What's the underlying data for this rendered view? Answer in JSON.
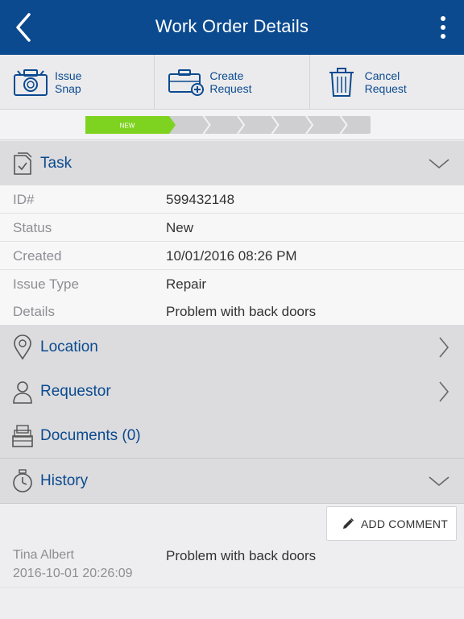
{
  "header": {
    "title": "Work Order Details",
    "back_icon": "chevron-left-icon",
    "menu_icon": "more-vertical-icon"
  },
  "actions": [
    {
      "label": "Issue\nSnap",
      "icon": "camera-icon"
    },
    {
      "label": "Create\nRequest",
      "icon": "toolbox-add-icon"
    },
    {
      "label": "Cancel\nRequest",
      "icon": "trash-icon"
    }
  ],
  "progress": {
    "steps_total": 7,
    "current_step": 1,
    "current_label": "NEW",
    "active_color": "#7ed321",
    "inactive_color": "#cfcfd2"
  },
  "sections": {
    "task": {
      "title": "Task",
      "icon": "task-document-icon"
    },
    "location": {
      "title": "Location",
      "icon": "map-pin-icon"
    },
    "requestor": {
      "title": "Requestor",
      "icon": "person-icon"
    },
    "documents": {
      "title": "Documents (0)",
      "icon": "documents-icon"
    },
    "history": {
      "title": "History",
      "icon": "stopwatch-icon"
    }
  },
  "task_details": [
    {
      "key": "ID#",
      "value": "599432148"
    },
    {
      "key": "Status",
      "value": "New"
    },
    {
      "key": "Created",
      "value": "10/01/2016 08:26 PM"
    },
    {
      "key": "Issue Type",
      "value": "Repair"
    },
    {
      "key": "Details",
      "value": "Problem with back doors"
    }
  ],
  "history": {
    "add_comment_label": "ADD COMMENT",
    "entries": [
      {
        "author": "Tina Albert",
        "timestamp": "2016-10-01 20:26:09",
        "message": "Problem with back doors"
      }
    ]
  },
  "colors": {
    "primary": "#0b4a8f",
    "accent_green": "#7ed321"
  }
}
